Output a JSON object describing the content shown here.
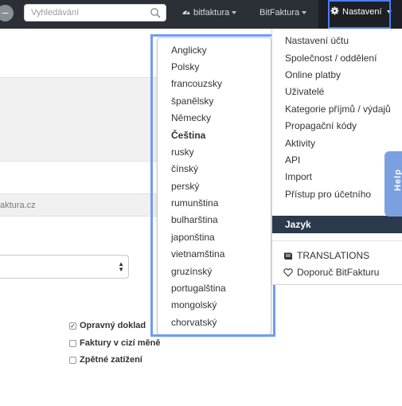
{
  "navbar": {
    "search_placeholder": "Vyhledávání",
    "account_label": "bitfaktura",
    "brand_label": "BitFaktura",
    "settings_label": "Nastavení"
  },
  "page": {
    "partial_url": "aktura.cz",
    "checkboxes": [
      {
        "label": "Opravný doklad",
        "checked": true
      },
      {
        "label": "Faktury v cizí měně",
        "checked": false
      },
      {
        "label": "Zpětné zatížení",
        "checked": false
      }
    ]
  },
  "language_menu": {
    "items": [
      "Anglicky",
      "Polsky",
      "francouzsky",
      "španělsky",
      "Německy",
      "Čeština",
      "rusky",
      "čínský",
      "perský",
      "rumunština",
      "bulharština",
      "japonština",
      "vietnamština",
      "gruzínský",
      "portugalština",
      "mongolský",
      "chorvatský"
    ],
    "active": "Čeština"
  },
  "settings_menu": {
    "items": [
      "Nastavení účtu",
      "Společnost / oddělení",
      "Online platby",
      "Uživatelé",
      "Kategorie příjmů / výdajů",
      "Propagační kódy",
      "Aktivity",
      "API",
      "Import",
      "Přístup pro účetního"
    ],
    "active_label": "Jazyk",
    "translations_label": "TRANSLATIONS",
    "recommend_label": "Doporuč BitFakturu"
  },
  "help_tab": {
    "label": "Help"
  },
  "colors": {
    "navbar": "#2b3037",
    "accent_outline": "#4a7cf7",
    "active_item": "#2b3a4c",
    "help_tab": "#7ba0e0"
  }
}
